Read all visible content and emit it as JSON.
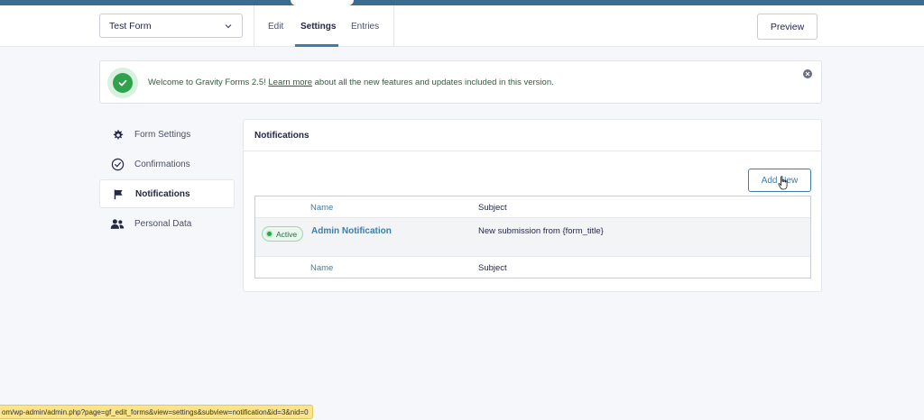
{
  "toolbar": {
    "form_select_value": "Test Form",
    "tabs": [
      {
        "label": "Edit"
      },
      {
        "label": "Settings"
      },
      {
        "label": "Entries"
      }
    ],
    "preview_label": "Preview"
  },
  "notice": {
    "text_before": "Welcome to Gravity Forms 2.5!",
    "link_text": "Learn more",
    "text_after": "about all the new features and updates included in this version."
  },
  "sidenav": {
    "items": [
      {
        "label": "Form Settings",
        "icon": "gear-icon"
      },
      {
        "label": "Confirmations",
        "icon": "check-circle-icon"
      },
      {
        "label": "Notifications",
        "icon": "flag-icon",
        "active": true
      },
      {
        "label": "Personal Data",
        "icon": "users-icon"
      }
    ]
  },
  "panel": {
    "title": "Notifications",
    "add_new_label": "Add New",
    "table": {
      "columns": [
        "Name",
        "Subject"
      ],
      "rows": [
        {
          "status": "Active",
          "name": "Admin Notification",
          "subject": "New submission from {form_title}"
        }
      ]
    }
  },
  "statusbar": {
    "url": "om/wp-admin/admin.php?page=gf_edit_forms&view=settings&subview=notification&id=3&nid=0"
  },
  "colors": {
    "accent": "#3e7da6",
    "success": "#31a24c",
    "topbar": "#3b6b8f"
  }
}
